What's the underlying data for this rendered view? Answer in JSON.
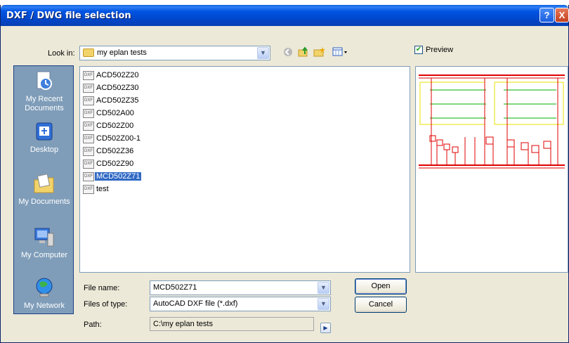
{
  "window": {
    "title": "DXF / DWG file selection",
    "help_label": "?",
    "close_label": "X"
  },
  "lookin": {
    "label": "Look in:",
    "value": "my eplan tests"
  },
  "preview": {
    "label": "Preview",
    "checked": true
  },
  "places": [
    {
      "label": "My Recent Documents",
      "icon": "recent-documents-icon"
    },
    {
      "label": "Desktop",
      "icon": "desktop-icon"
    },
    {
      "label": "My Documents",
      "icon": "my-documents-icon"
    },
    {
      "label": "My Computer",
      "icon": "my-computer-icon"
    },
    {
      "label": "My Network",
      "icon": "my-network-icon"
    }
  ],
  "files": [
    {
      "name": "ACD502Z20",
      "selected": false
    },
    {
      "name": "ACD502Z30",
      "selected": false
    },
    {
      "name": "ACD502Z35",
      "selected": false
    },
    {
      "name": "CD502A00",
      "selected": false
    },
    {
      "name": "CD502Z00",
      "selected": false
    },
    {
      "name": "CD502Z00-1",
      "selected": false
    },
    {
      "name": "CD502Z36",
      "selected": false
    },
    {
      "name": "CD502Z90",
      "selected": false
    },
    {
      "name": "MCD502Z71",
      "selected": true
    },
    {
      "name": "test",
      "selected": false
    }
  ],
  "file_icon_text": "DXF",
  "filename": {
    "label": "File name:",
    "value": "MCD502Z71"
  },
  "filetype": {
    "label": "Files of type:",
    "value": "AutoCAD DXF file (*.dxf)"
  },
  "path": {
    "label": "Path:",
    "value": "C:\\my eplan tests"
  },
  "buttons": {
    "open": "Open",
    "cancel": "Cancel"
  },
  "colors": {
    "title_blue": "#0054e3",
    "selection": "#316ac5",
    "places_bg": "#7f9db9",
    "dialog_bg": "#ece9d8",
    "drawing_red": "#e00000",
    "drawing_yellow": "#e8e000",
    "drawing_green": "#00b000"
  }
}
